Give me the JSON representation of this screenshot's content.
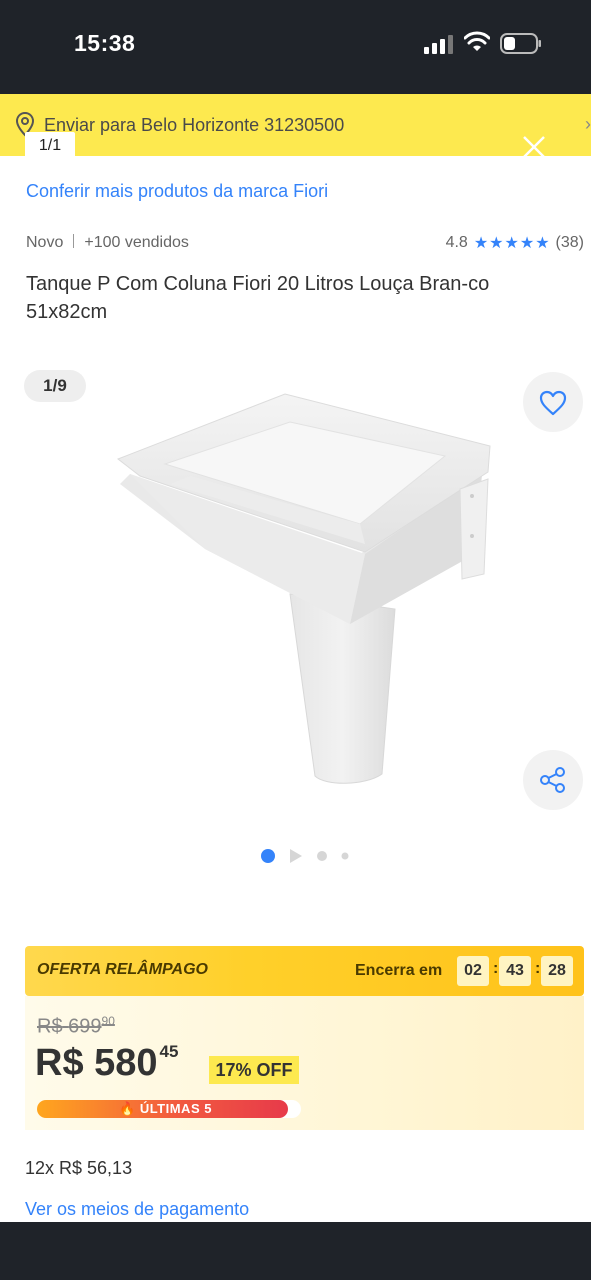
{
  "status_bar": {
    "time": "15:38"
  },
  "shipping": {
    "text": "Enviar para Belo Horizonte 31230500"
  },
  "viewer": {
    "counter": "1/1"
  },
  "brand_link": "Conferir mais produtos da marca Fiori",
  "meta": {
    "condition": "Novo",
    "sold": "+100 vendidos",
    "rating_value": "4.8",
    "rating_count": "(38)",
    "stars": 5
  },
  "title": "Tanque P Com Coluna Fiori 20 Litros Louça Bran-co 51x82cm",
  "gallery": {
    "counter": "1/9"
  },
  "flash_offer": {
    "label": "OFERTA RELÂMPAGO",
    "ends_label": "Encerra em",
    "hours": "02",
    "minutes": "43",
    "seconds": "28"
  },
  "price": {
    "old_currency": "R$",
    "old_int": "699",
    "old_cents": "90",
    "new_currency": "R$",
    "new_int": "580",
    "new_cents": "45",
    "discount": "17% OFF",
    "stock_label": "ÚLTIMAS 5",
    "stock_level": 0.95
  },
  "installments": "12x R$ 56,13",
  "payment_link": "Ver os meios de pagamento",
  "colors": {
    "accent_blue": "#3483fa",
    "brand_yellow": "#fde94f"
  }
}
